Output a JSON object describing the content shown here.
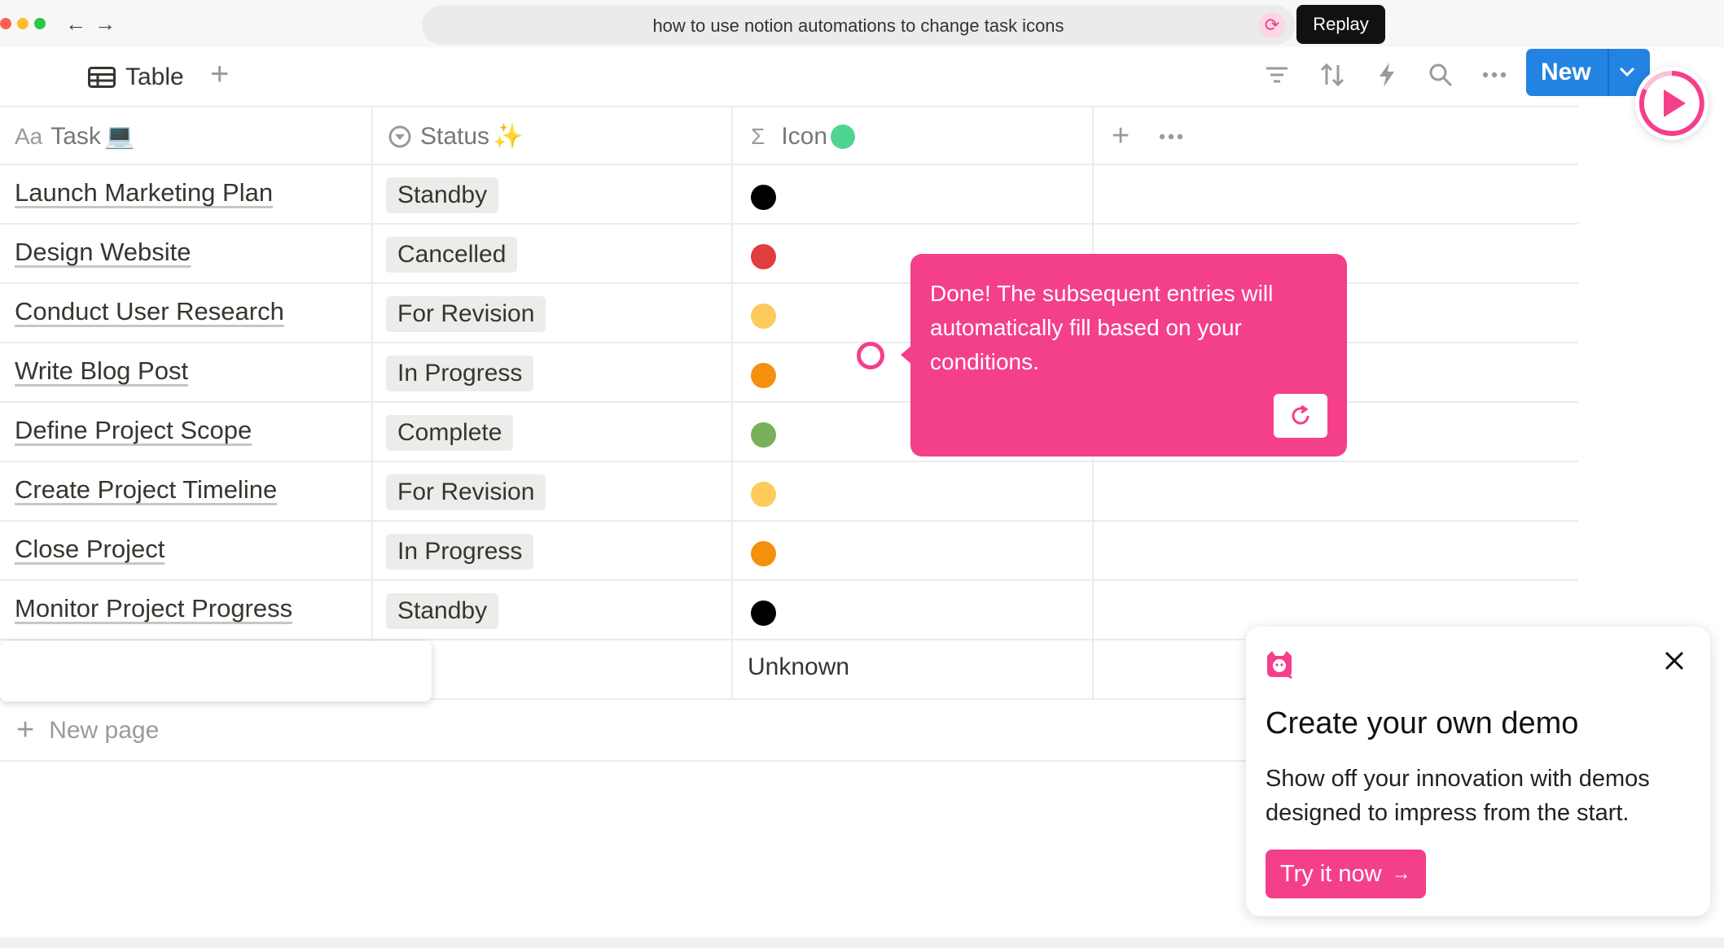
{
  "browser": {
    "address_text": "how to use notion automations to change task icons",
    "replay_label": "Replay",
    "traffic_colors": [
      "#ff5f57",
      "#febc2e",
      "#28c840"
    ]
  },
  "toolbar": {
    "view_label": "Table",
    "new_label": "New"
  },
  "table": {
    "headers": {
      "task": "Task",
      "task_emoji": "💻",
      "status": "Status",
      "status_emoji": "✨",
      "icon": "Icon"
    },
    "rows": [
      {
        "task": "Launch Marketing Plan",
        "status": "Standby",
        "icon_color": "#000000"
      },
      {
        "task": "Design Website",
        "status": "Cancelled",
        "icon_color": "#e03e3e"
      },
      {
        "task": "Conduct User Research",
        "status": "For Revision",
        "icon_color": "#fdcb5c"
      },
      {
        "task": "Write Blog Post",
        "status": "In Progress",
        "icon_color": "#f4900c"
      },
      {
        "task": "Define Project Scope",
        "status": "Complete",
        "icon_color": "#78b159"
      },
      {
        "task": "Create Project Timeline",
        "status": "For Revision",
        "icon_color": "#fdcb5c"
      },
      {
        "task": "Close Project",
        "status": "In Progress",
        "icon_color": "#f4900c"
      },
      {
        "task": "Monitor Project Progress",
        "status": "Standby",
        "icon_color": "#000000"
      }
    ],
    "unknown_value": "Unknown",
    "new_page_label": "New page"
  },
  "callout": {
    "text": "Done! The subsequent entries will automatically fill based on your conditions.",
    "accent": "#f43f8b"
  },
  "promo": {
    "title": "Create your own demo",
    "description": "Show off your innovation with demos designed to impress from the start.",
    "cta_label": "Try it now"
  }
}
